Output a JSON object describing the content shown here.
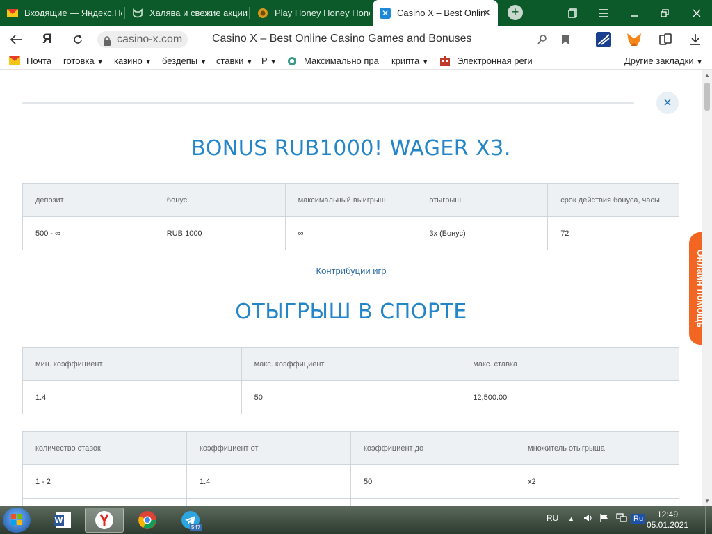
{
  "browser": {
    "tabs": [
      {
        "title": "Входящие — Яндекс.Почта",
        "active": false
      },
      {
        "title": "Халява и свежие акции",
        "active": false
      },
      {
        "title": "Play Honey Honey Honey",
        "active": false
      },
      {
        "title": "Casino X – Best Online Casino Games",
        "active": true
      }
    ],
    "new_tab_label": "+",
    "url": "casino-x.com",
    "page_title": "Casino X – Best Online Casino Games and Bonuses",
    "yandex_label": "Я",
    "bookmarks": [
      {
        "label": "Почта",
        "dropdown": false
      },
      {
        "label": "готовка",
        "dropdown": true
      },
      {
        "label": "казино",
        "dropdown": true
      },
      {
        "label": "бездепы",
        "dropdown": true
      },
      {
        "label": "ставки",
        "dropdown": true
      },
      {
        "label": "Р",
        "dropdown": true
      },
      {
        "label": "Максимально пра",
        "dropdown": false
      },
      {
        "label": "крипта",
        "dropdown": true
      },
      {
        "label": "Электронная реги",
        "dropdown": false
      }
    ],
    "other_bookmarks": "Другие закладки",
    "caret": "▼"
  },
  "page": {
    "bonus_heading": "BONUS RUB1000! WAGER X3.",
    "bonus_table": {
      "headers": [
        "депозит",
        "бонус",
        "максимальный выигрыш",
        "отыгрыш",
        "срок действия бонуса, часы"
      ],
      "rows": [
        [
          "500 - ∞",
          "RUB 1000",
          "∞",
          "3x (Бонус)",
          "72"
        ]
      ]
    },
    "contributions_link": "Контрибуции игр",
    "sport_heading": "ОТЫГРЫШ В СПОРТЕ",
    "sport_table": {
      "headers": [
        "мин. коэффициент",
        "макс. коэффициент",
        "макс. ставка"
      ],
      "rows": [
        [
          "1.4",
          "50",
          "12,500.00"
        ]
      ]
    },
    "multiplier_table": {
      "headers": [
        "количество ставок",
        "коэффициент от",
        "коэффициент до",
        "множитель отыгрыша"
      ],
      "rows": [
        [
          "1 - 2",
          "1.4",
          "50",
          "x2"
        ],
        [
          "",
          "",
          "",
          ""
        ]
      ]
    },
    "close_label": "×",
    "help_label": "Онлайн помощь"
  },
  "taskbar": {
    "telegram_badge": "547",
    "lang": "RU",
    "ime": "Ru",
    "time": "12:49",
    "date": "05.01.2021"
  },
  "colors": {
    "accent_blue": "#2386c8",
    "help_orange": "#f26522",
    "tabbar_green": "#0c5a2a",
    "header_cell_bg": "#edf1f4"
  }
}
